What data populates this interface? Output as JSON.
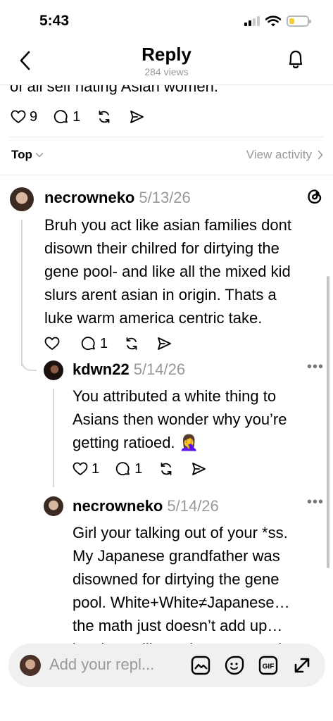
{
  "status_bar": {
    "time": "5:43"
  },
  "header": {
    "title": "Reply",
    "views": "284 views"
  },
  "parent_post": {
    "last_line": "of all self hating Asian women.",
    "likes": "9",
    "replies": "1"
  },
  "sort": {
    "label": "Top",
    "view_activity": "View activity"
  },
  "comments": [
    {
      "username": "necrowneko",
      "date": "5/13/26",
      "lines": [
        "Bruh you act like asian families dont",
        "disown their chilred for dirtying the",
        "gene pool- and like all the mixed kid",
        "slurs arent asian in origin. Thats a",
        "luke warm america centric take."
      ],
      "replies": "1"
    },
    {
      "username": "kdwn22",
      "date": "5/14/26",
      "lines": [
        "You attributed a white thing to",
        "Asians then wonder why you’re",
        "getting ratioed. 🤦‍♀️"
      ],
      "likes": "1",
      "replies": "1"
    },
    {
      "username": "necrowneko",
      "date": "5/14/26",
      "lines": [
        "Girl your talking out of your *ss.",
        "My Japanese grandfather was",
        "disowned for dirtying the gene",
        "pool. White+White≠Japanese…",
        "the math just doesn’t add up…",
        "its almost like… the parents who"
      ]
    }
  ],
  "more_label": "•••",
  "reply_bar": {
    "placeholder": "Add your repl..."
  },
  "icons": [
    "back-icon",
    "bell-icon",
    "heart-icon",
    "comment-icon",
    "repost-icon",
    "share-icon",
    "threads-logo-icon",
    "image-icon",
    "sticker-icon",
    "gif-icon",
    "expand-icon"
  ]
}
